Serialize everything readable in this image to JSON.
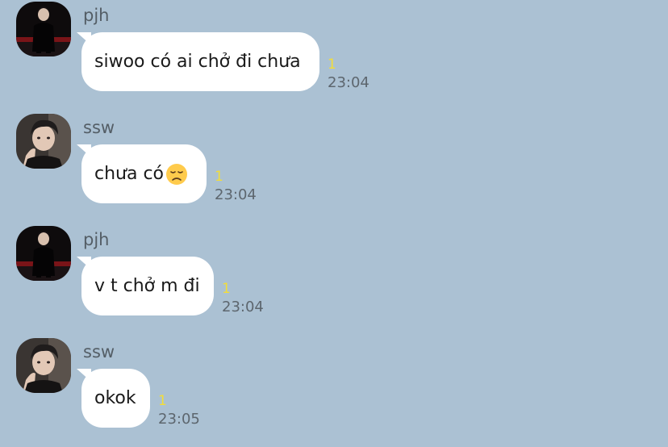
{
  "colors": {
    "background": "#abc1d3",
    "bubble": "#ffffff",
    "read_count": "#f3dd38",
    "meta_text": "#5d666e",
    "sender_text": "#545e66"
  },
  "messages": [
    {
      "sender": "pjh",
      "avatar": "avatar-pjh",
      "text": "siwoo có ai chở đi chưa",
      "emoji": "",
      "read_count": "1",
      "time": "23:04"
    },
    {
      "sender": "ssw",
      "avatar": "avatar-ssw",
      "text": "chưa có",
      "emoji": "disappointed-face-icon",
      "read_count": "1",
      "time": "23:04"
    },
    {
      "sender": "pjh",
      "avatar": "avatar-pjh",
      "text": "v t chở m đi",
      "emoji": "",
      "read_count": "1",
      "time": "23:04"
    },
    {
      "sender": "ssw",
      "avatar": "avatar-ssw",
      "text": "okok",
      "emoji": "",
      "read_count": "1",
      "time": "23:05"
    }
  ]
}
